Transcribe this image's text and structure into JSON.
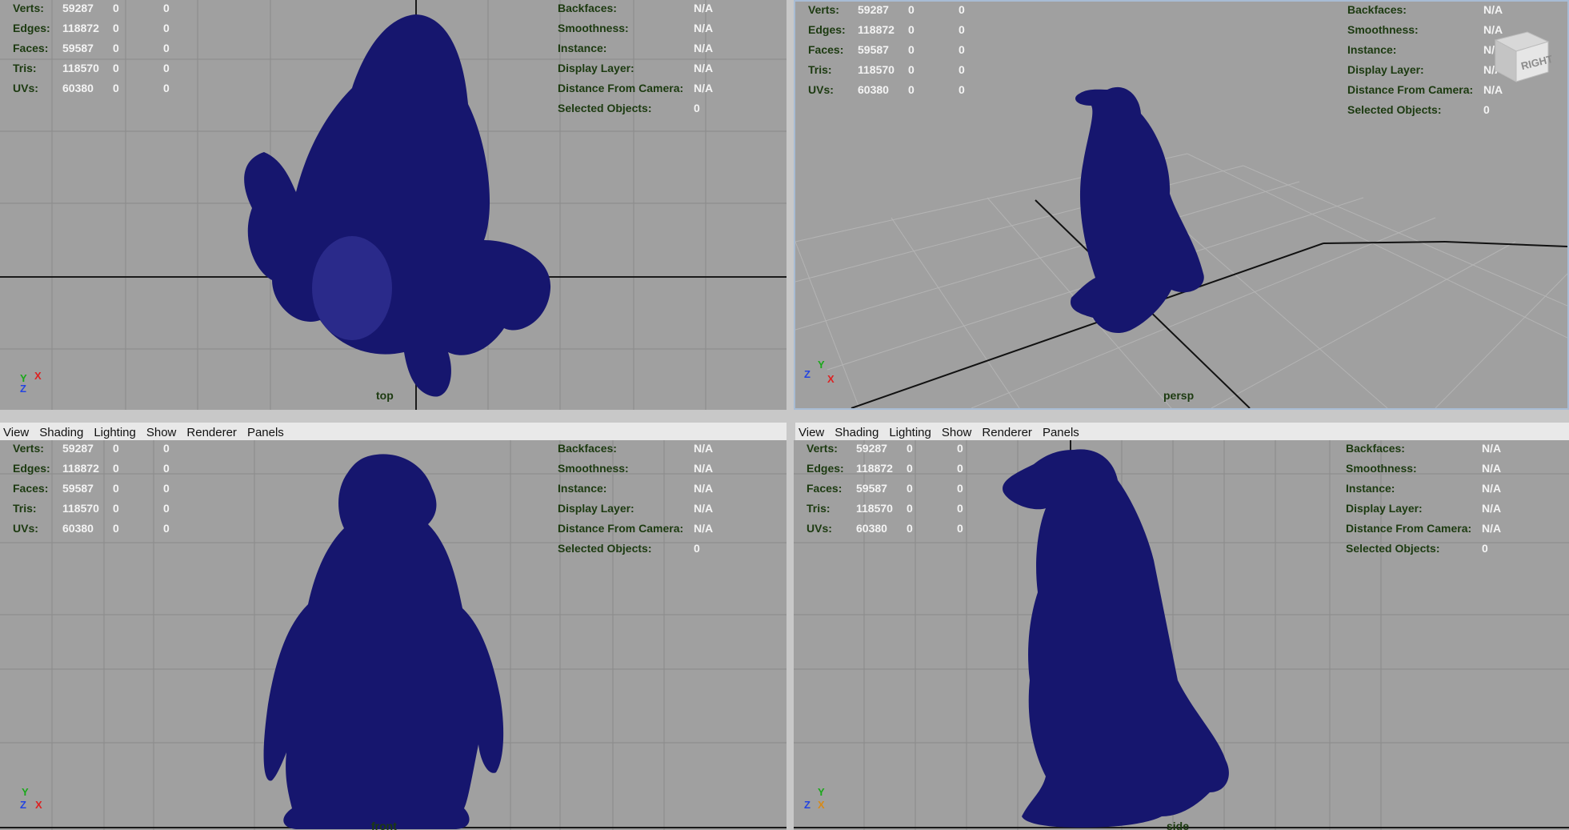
{
  "stats": {
    "rows": [
      {
        "label": "Verts:",
        "v1": "59287",
        "v2": "0",
        "v3": "0"
      },
      {
        "label": "Edges:",
        "v1": "118872",
        "v2": "0",
        "v3": "0"
      },
      {
        "label": "Faces:",
        "v1": "59587",
        "v2": "0",
        "v3": "0"
      },
      {
        "label": "Tris:",
        "v1": "118570",
        "v2": "0",
        "v3": "0"
      },
      {
        "label": "UVs:",
        "v1": "60380",
        "v2": "0",
        "v3": "0"
      }
    ]
  },
  "info": {
    "rows": [
      {
        "label": "Backfaces:",
        "value": "N/A"
      },
      {
        "label": "Smoothness:",
        "value": "N/A"
      },
      {
        "label": "Instance:",
        "value": "N/A"
      },
      {
        "label": "Display Layer:",
        "value": "N/A"
      },
      {
        "label": "Distance From Camera:",
        "value": "N/A"
      },
      {
        "label": "Selected Objects:",
        "value": "0"
      }
    ]
  },
  "menu": {
    "items": [
      "View",
      "Shading",
      "Lighting",
      "Show",
      "Renderer",
      "Panels"
    ]
  },
  "cameras": {
    "top": "top",
    "persp": "persp",
    "front": "front",
    "side": "side"
  },
  "viewcube": {
    "face": "RIGHT"
  },
  "axis_labels": {
    "x": "X",
    "y": "Y",
    "z": "Z"
  },
  "colors": {
    "viewport_bg": "#a0a0a0",
    "mesh": "#16166e",
    "hud_label": "#1c3a10",
    "hud_value": "#f4f4f4"
  }
}
